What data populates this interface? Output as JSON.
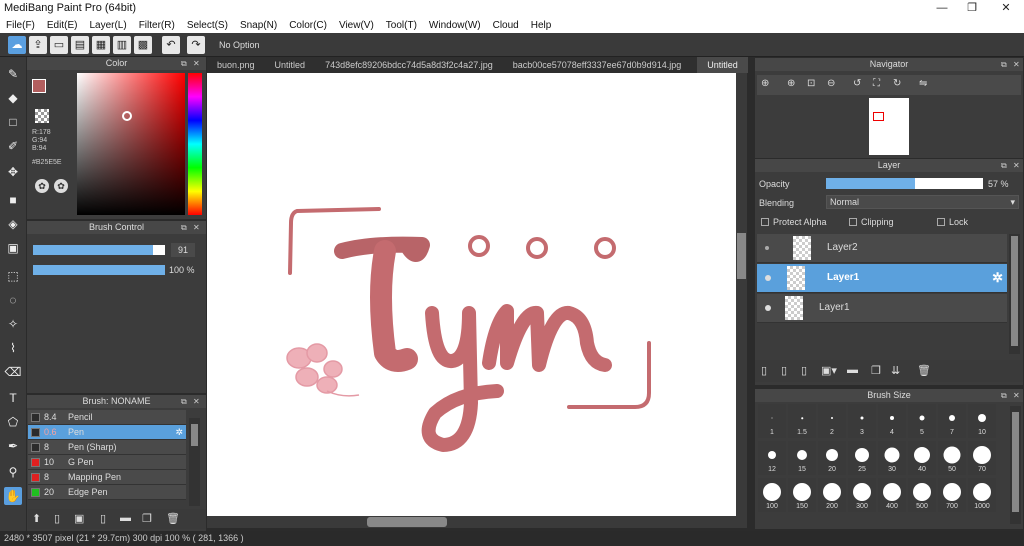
{
  "window": {
    "title": "MediBang Paint Pro (64bit)",
    "min": "—",
    "max": "❐",
    "close": "✕"
  },
  "menu": [
    "File(F)",
    "Edit(E)",
    "Layer(L)",
    "Filter(R)",
    "Select(S)",
    "Snap(N)",
    "Color(C)",
    "View(V)",
    "Tool(T)",
    "Window(W)",
    "Cloud",
    "Help"
  ],
  "toolbar": {
    "option": "No Option"
  },
  "color_panel": {
    "title": "Color",
    "r": "R:178",
    "g": "G:94",
    "b": "B:94",
    "hex": "#B25E5E",
    "fg": "#b25e5e"
  },
  "brush_control": {
    "title": "Brush Control",
    "size": "91",
    "opacity": "100 %",
    "size_frac": 0.91,
    "opacity_frac": 1.0
  },
  "brush_list": {
    "title": "Brush: NONAME",
    "items": [
      {
        "size": "8.4",
        "name": "Pencil",
        "color": "#2b2b2b"
      },
      {
        "size": "0.6",
        "name": "Pen",
        "color": "#2b2b2b",
        "selected": true
      },
      {
        "size": "8",
        "name": "Pen (Sharp)",
        "color": "#2b2b2b"
      },
      {
        "size": "10",
        "name": "G Pen",
        "color": "#e02020"
      },
      {
        "size": "8",
        "name": "Mapping Pen",
        "color": "#e02020"
      },
      {
        "size": "20",
        "name": "Edge Pen",
        "color": "#20c020"
      }
    ]
  },
  "tabs": [
    "buon.png",
    "Untitled",
    "743d8efc89206bdcc74d5a8d3f2c4a27.jpg",
    "bacb00ce57078eff3337ee67d0b9d914.jpg",
    "Untitled"
  ],
  "active_tab": 4,
  "navigator": {
    "title": "Navigator"
  },
  "layer_panel": {
    "title": "Layer",
    "opacity_label": "Opacity",
    "opacity": "57 %",
    "opacity_frac": 0.57,
    "blending_label": "Blending",
    "blending": "Normal",
    "protect_alpha": "Protect Alpha",
    "clipping": "Clipping",
    "lock": "Lock",
    "layers": [
      {
        "name": "Layer2"
      },
      {
        "name": "Layer1",
        "selected": true
      },
      {
        "name": "Layer1"
      }
    ]
  },
  "brush_size": {
    "title": "Brush Size",
    "sizes": [
      "1",
      "1.5",
      "2",
      "3",
      "4",
      "5",
      "7",
      "10",
      "12",
      "15",
      "20",
      "25",
      "30",
      "40",
      "50",
      "70",
      "100",
      "150",
      "200",
      "300",
      "400",
      "500",
      "700",
      "1000"
    ]
  },
  "status": "2480 * 3507 pixel   (21 * 29.7cm)   300 dpi   100 %   ( 281, 1366 )",
  "artwork": {
    "text": "Tym",
    "color": "#c46b6f"
  }
}
